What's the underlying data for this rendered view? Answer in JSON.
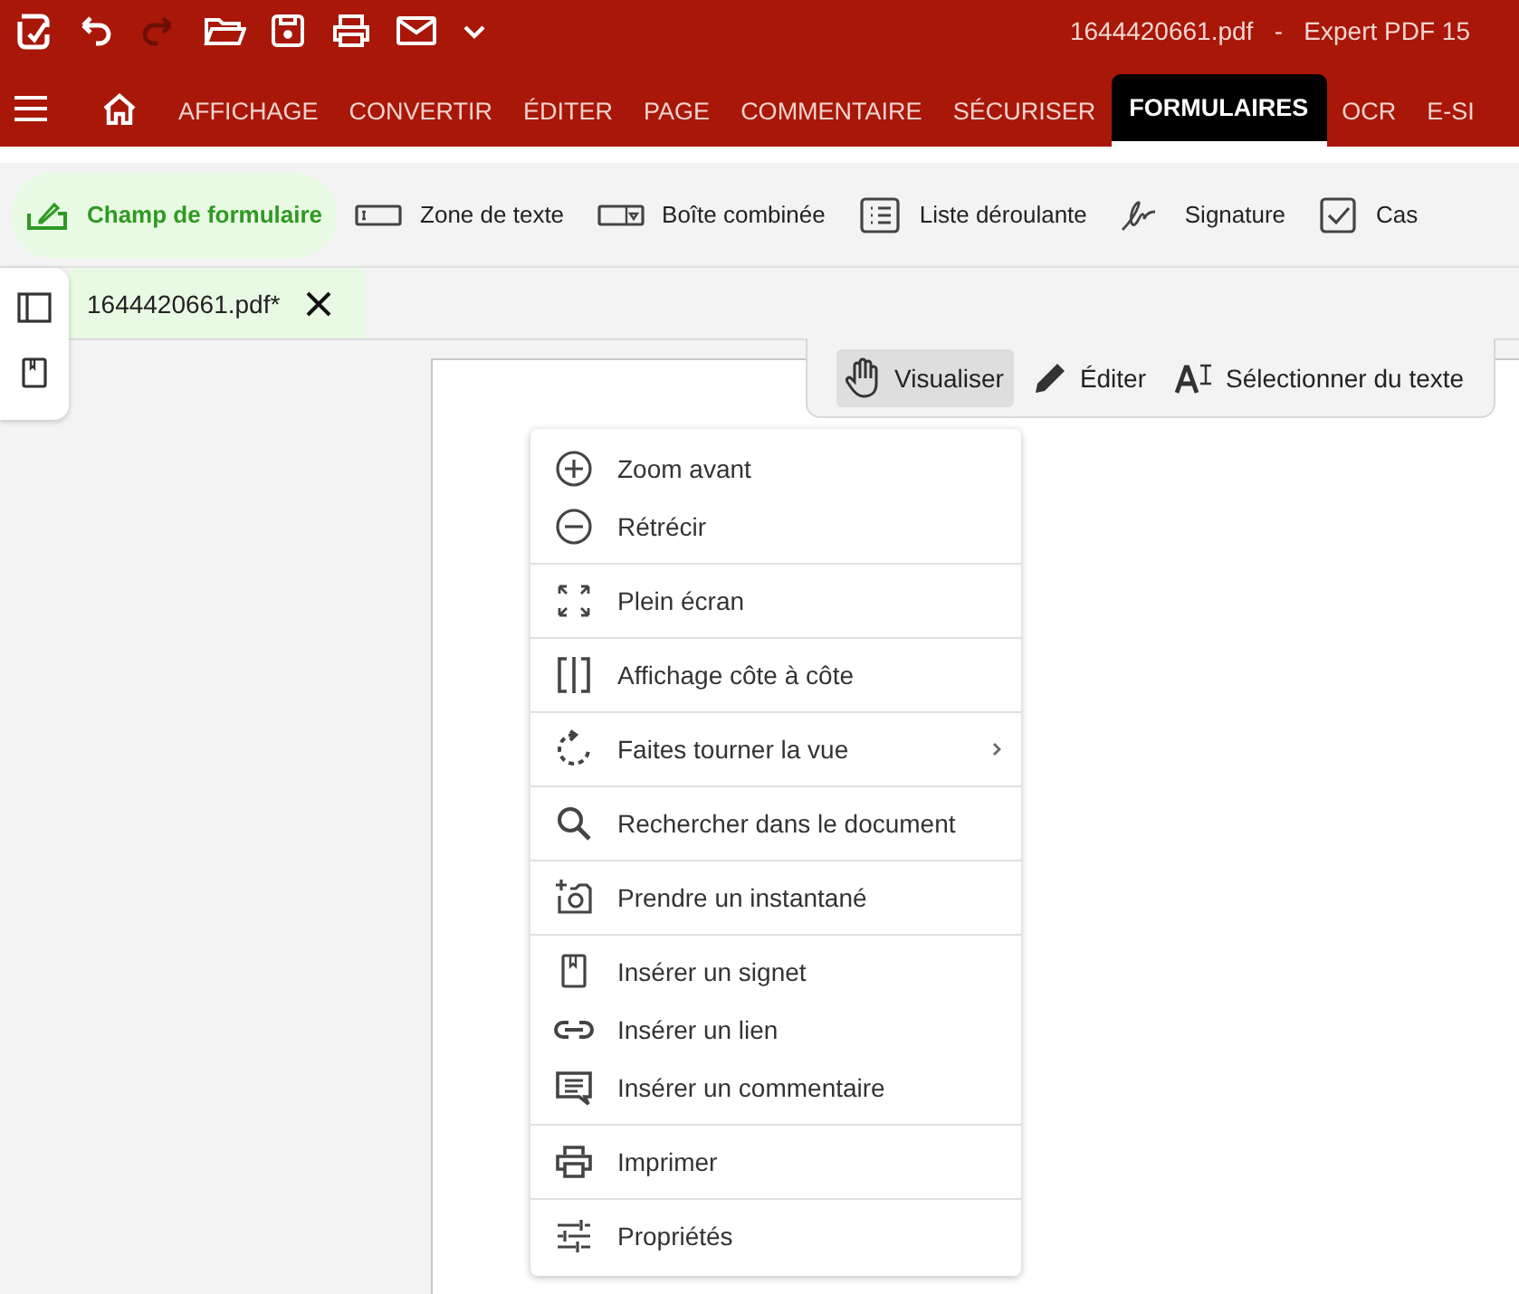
{
  "window": {
    "title": "1644420661.pdf   -   Expert PDF 15"
  },
  "quick_access": [
    {
      "disabled": false
    },
    {
      "disabled": false
    },
    {
      "disabled": true
    },
    {
      "disabled": false
    },
    {
      "disabled": false
    },
    {
      "disabled": false
    },
    {
      "disabled": false
    },
    {
      "disabled": false
    }
  ],
  "ribbon_tabs": [
    {
      "label": "AFFICHAGE",
      "selected": false
    },
    {
      "label": "CONVERTIR",
      "selected": false
    },
    {
      "label": "ÉDITER",
      "selected": false
    },
    {
      "label": "PAGE",
      "selected": false
    },
    {
      "label": "COMMENTAIRE",
      "selected": false
    },
    {
      "label": "SÉCURISER",
      "selected": false
    },
    {
      "label": "FORMULAIRES",
      "selected": true
    },
    {
      "label": "OCR",
      "selected": false
    },
    {
      "label": "E-SI",
      "selected": false
    }
  ],
  "toolbar": [
    {
      "label": "Champ de formulaire",
      "selected": true
    },
    {
      "label": "Zone de texte",
      "selected": false
    },
    {
      "label": "Boîte combinée",
      "selected": false
    },
    {
      "label": "Liste déroulante",
      "selected": false
    },
    {
      "label": "Signature",
      "selected": false
    },
    {
      "label": "Cas",
      "selected": false
    }
  ],
  "document_tabs": [
    {
      "label": "1644420661.pdf*",
      "selected": true
    }
  ],
  "view_modes": [
    {
      "label": "Visualiser",
      "selected": true
    },
    {
      "label": "Éditer",
      "selected": false
    },
    {
      "label": "Sélectionner du texte",
      "selected": false
    }
  ],
  "context_menu": [
    [
      {
        "label": "Zoom avant",
        "has_submenu": false
      },
      {
        "label": "Rétrécir",
        "has_submenu": false
      }
    ],
    [
      {
        "label": "Plein écran",
        "has_submenu": false
      }
    ],
    [
      {
        "label": "Affichage côte à côte",
        "has_submenu": false
      }
    ],
    [
      {
        "label": "Faites tourner la vue",
        "has_submenu": true
      }
    ],
    [
      {
        "label": "Rechercher dans le document",
        "has_submenu": false
      }
    ],
    [
      {
        "label": "Prendre un instantané",
        "has_submenu": false
      }
    ],
    [
      {
        "label": "Insérer un signet",
        "has_submenu": false
      },
      {
        "label": "Insérer un lien",
        "has_submenu": false
      },
      {
        "label": "Insérer un commentaire",
        "has_submenu": false
      }
    ],
    [
      {
        "label": "Imprimer",
        "has_submenu": false
      }
    ],
    [
      {
        "label": "Propriétés",
        "has_submenu": false
      }
    ]
  ]
}
